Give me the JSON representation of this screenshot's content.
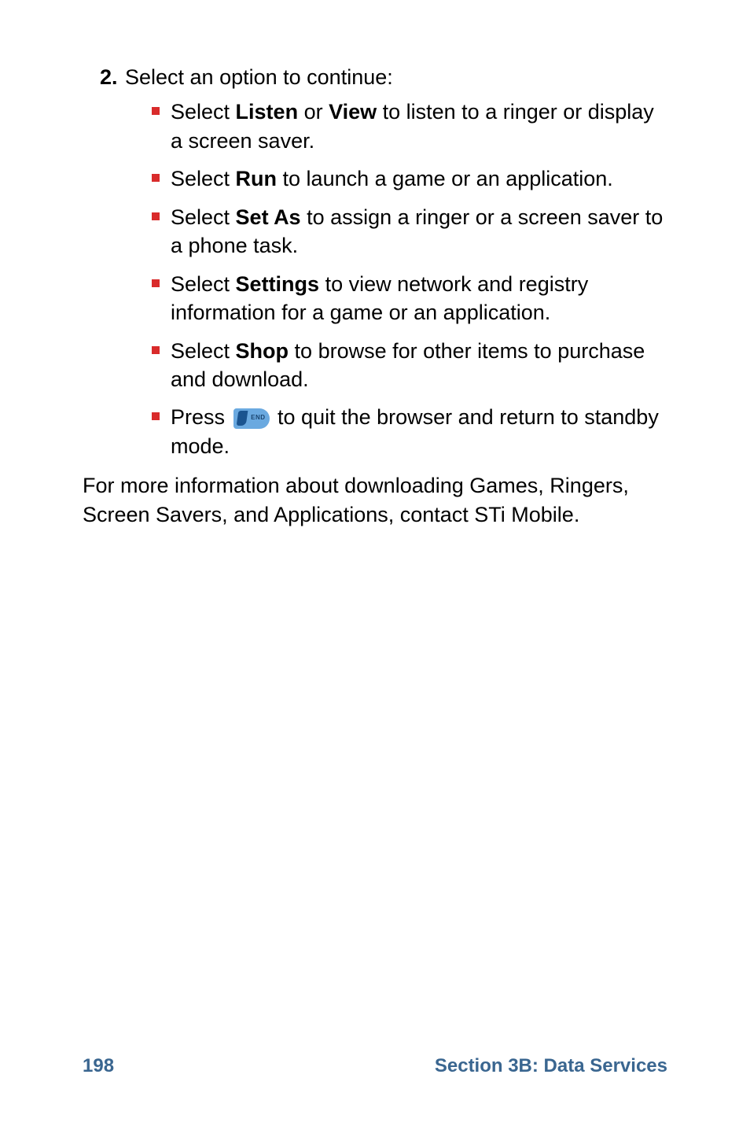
{
  "step": {
    "number": "2.",
    "text": "Select an option to continue:"
  },
  "bullets": [
    {
      "prefix": "Select ",
      "bold1": "Listen",
      "mid": " or ",
      "bold2": "View",
      "suffix": " to listen to a ringer or display a screen saver."
    },
    {
      "prefix": "Select ",
      "bold1": "Run",
      "suffix": " to launch a game or an application."
    },
    {
      "prefix": "Select ",
      "bold1": "Set As",
      "suffix": " to assign a ringer or a screen saver to a phone task."
    },
    {
      "prefix": "Select ",
      "bold1": "Settings",
      "suffix": " to view network and registry information for a game or an application."
    },
    {
      "prefix": "Select ",
      "bold1": "Shop",
      "suffix": " to browse for other items to purchase and download."
    }
  ],
  "press_bullet": {
    "prefix": "Press ",
    "suffix": " to quit the browser and return to standby mode."
  },
  "closing": "For more information about downloading Games, Ringers, Screen Savers, and Applications, contact STi Mobile.",
  "footer": {
    "page": "198",
    "section": "Section 3B: Data Services"
  }
}
